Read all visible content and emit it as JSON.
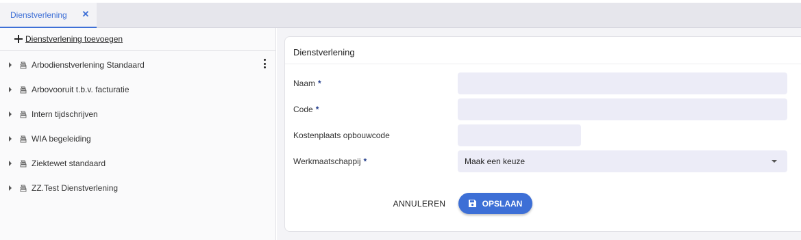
{
  "tab": {
    "label": "Dienstverlening",
    "close_symbol": "✕"
  },
  "sidebar": {
    "add_label": "Dienstverlening toevoegen",
    "items": [
      {
        "label": "Arbodienstverlening Standaard"
      },
      {
        "label": "Arbovooruit t.b.v. facturatie"
      },
      {
        "label": "Intern tijdschrijven"
      },
      {
        "label": "WIA begeleiding"
      },
      {
        "label": "Ziektewet standaard"
      },
      {
        "label": "ZZ.Test Dienstverlening"
      }
    ]
  },
  "form": {
    "title": "Dienstverlening",
    "naam_label": "Naam",
    "naam_value": "",
    "code_label": "Code",
    "code_value": "",
    "kostenplaats_label": "Kostenplaats opbouwcode",
    "kostenplaats_value": "",
    "werkmaatschappij_label": "Werkmaatschappij",
    "werkmaatschappij_value": "Maak een keuze",
    "required_marker": "*",
    "cancel_label": "ANNULEREN",
    "save_label": "OPSLAAN"
  },
  "colors": {
    "accent": "#3d6fd6",
    "input_bg": "#ececf7",
    "required": "#1f3a8a"
  }
}
